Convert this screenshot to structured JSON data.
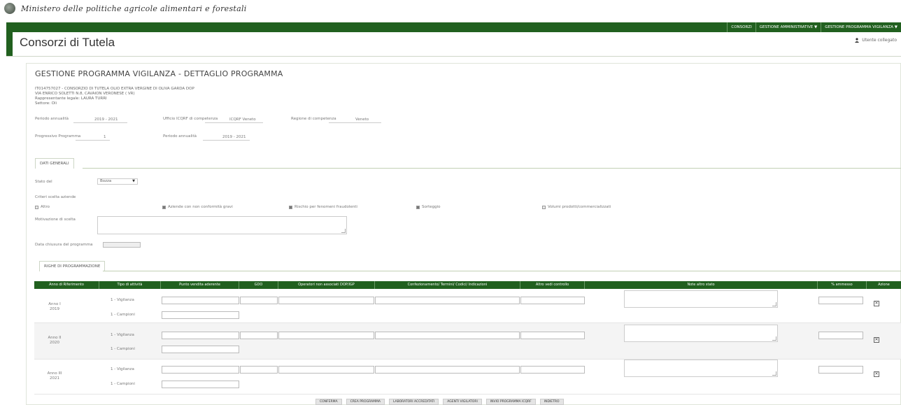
{
  "header": {
    "ministry": "Ministero delle politiche agricole alimentari e forestali",
    "app_title": "Consorzi di Tutela",
    "user": "Utente collegato"
  },
  "nav": {
    "items": [
      "CONSORZI",
      "GESTIONE AMMINISTRATIVE ▼",
      "GESTIONE PROGRAMMA VIGILANZA ▼"
    ]
  },
  "main": {
    "title": "GESTIONE PROGRAMMA VIGILANZA - DETTAGLIO PROGRAMMA",
    "info_lines": [
      "IT014757027 - CONSORZIO DI TUTELA OLIO EXTRA VERGINE DI OLIVA GARDA DOP",
      "VIA ENRICO SOLETTI N.8, CAVAION VERONESE ( VR)",
      "Rappresentante legale: LAURA TURRI",
      "Settore: Oli"
    ],
    "fields": {
      "periodo_label": "Periodo annualità",
      "periodo_value": "2019 - 2021",
      "ufficio_label": "Ufficio ICQRF di competenza",
      "ufficio_value": "ICQRF Veneto",
      "regione_label": "Regione di competenza",
      "regione_value": "Veneto",
      "progressivo_label": "Progressivo Programma",
      "progressivo_value": "1",
      "periodo2_label": "Periodo annualità",
      "periodo2_value": "2019 - 2021"
    }
  },
  "tabs": {
    "dati_generali": "DATI GENERALI",
    "righe": "RIGHE DI PROGRAMMAZIONE"
  },
  "general": {
    "stato_label": "Stato del",
    "stato_value": "Bozza",
    "criteri_label": "Criteri scelta aziende",
    "criteri": [
      {
        "label": "Altro",
        "checked": false
      },
      {
        "label": "Aziende con non conformità gravi",
        "checked": true
      },
      {
        "label": "Rischio per fenomeni fraudolenti",
        "checked": true
      },
      {
        "label": "Sorteggio",
        "checked": true
      },
      {
        "label": "Volumi prodotti/commercializzati",
        "checked": false
      }
    ],
    "motivazione_label": "Motivazione di scelta",
    "data_label": "Data chiusura del programma"
  },
  "table": {
    "headers": [
      "Anno di Riferimento",
      "Tipo di attività",
      "Punto vendita aderente",
      "GDO",
      "Operatori non associati DOP/IGP",
      "Confezionamento/ Termini/ Codici/ Indicazioni",
      "Altro vedi controllo",
      "Note altro stato",
      "% ammesso",
      "Azione"
    ],
    "rows": [
      {
        "year": "Anno I 2019",
        "sub1": "1 - Vigilanza",
        "sub2": "1 - Campioni"
      },
      {
        "year": "Anno II 2020",
        "sub1": "1 - Vigilanza",
        "sub2": "1 - Campioni"
      },
      {
        "year": "Anno III 2021",
        "sub1": "1 - Vigilanza",
        "sub2": "1 - Campioni"
      }
    ]
  },
  "buttons": [
    "CONFERMA",
    "CREA PROGRAMMA",
    "LABORATORI ACCREDITATI",
    "AGENTI VIGILATORI",
    "INVIO PROGRAMMA ICQRF",
    "INDIETRO"
  ],
  "colors": {
    "brand_green": "#21601f"
  }
}
